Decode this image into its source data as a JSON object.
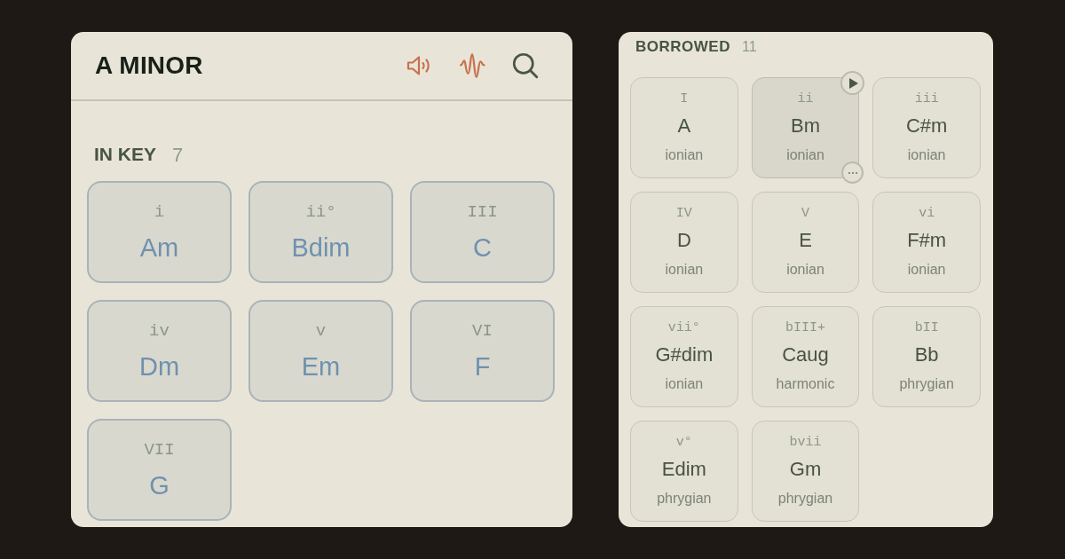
{
  "key_panel": {
    "title": "A MINOR",
    "actions": [
      {
        "kind": "speaker",
        "active": true
      },
      {
        "kind": "wave",
        "active": true
      },
      {
        "kind": "search",
        "active": false
      }
    ],
    "section": {
      "title": "IN KEY",
      "count": "7",
      "chords": [
        {
          "numeral": "i",
          "name": "Am"
        },
        {
          "numeral": "ii°",
          "name": "Bdim"
        },
        {
          "numeral": "III",
          "name": "C"
        },
        {
          "numeral": "iv",
          "name": "Dm"
        },
        {
          "numeral": "v",
          "name": "Em"
        },
        {
          "numeral": "VI",
          "name": "F"
        },
        {
          "numeral": "VII",
          "name": "G"
        }
      ]
    }
  },
  "borrowed_panel": {
    "title": "BORROWED",
    "count": "11",
    "chords": [
      {
        "numeral": "I",
        "name": "A",
        "mode": "ionian",
        "selected": false
      },
      {
        "numeral": "ii",
        "name": "Bm",
        "mode": "ionian",
        "selected": true
      },
      {
        "numeral": "iii",
        "name": "C#m",
        "mode": "ionian",
        "selected": false
      },
      {
        "numeral": "IV",
        "name": "D",
        "mode": "ionian",
        "selected": false
      },
      {
        "numeral": "V",
        "name": "E",
        "mode": "ionian",
        "selected": false
      },
      {
        "numeral": "vi",
        "name": "F#m",
        "mode": "ionian",
        "selected": false
      },
      {
        "numeral": "vii°",
        "name": "G#dim",
        "mode": "ionian",
        "selected": false
      },
      {
        "numeral": "bIII+",
        "name": "Caug",
        "mode": "harmonic",
        "selected": false
      },
      {
        "numeral": "bII",
        "name": "Bb",
        "mode": "phrygian",
        "selected": false
      },
      {
        "numeral": "v°",
        "name": "Edim",
        "mode": "phrygian",
        "selected": false
      },
      {
        "numeral": "bvii",
        "name": "Gm",
        "mode": "phrygian",
        "selected": false
      }
    ]
  }
}
